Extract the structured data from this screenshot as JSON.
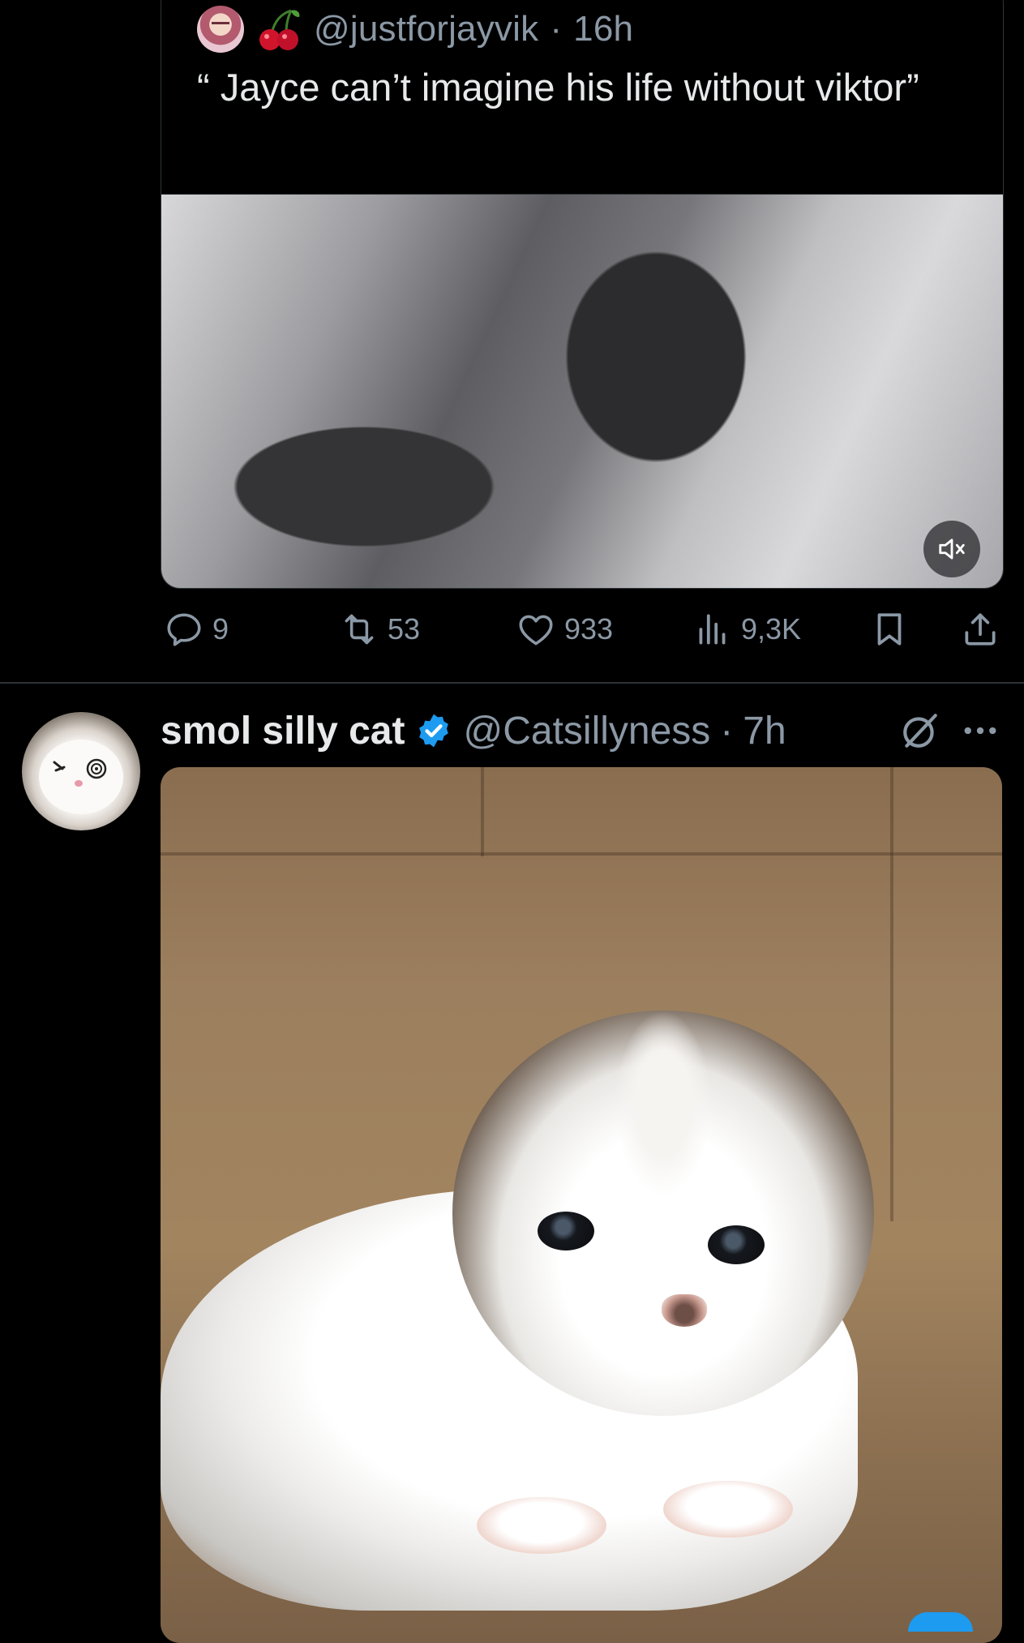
{
  "quoted_tweet": {
    "handle": "@justforjayvik",
    "separator": "·",
    "time": "16h",
    "text": "“ Jayce can’t imagine his life without viktor”",
    "media": {
      "type": "video",
      "muted": true
    }
  },
  "actions": {
    "replies": "9",
    "reposts": "53",
    "likes": "933",
    "views": "9,3K"
  },
  "tweet": {
    "display_name": "smol silly cat",
    "verified": true,
    "handle": "@Catsillyness",
    "separator": "·",
    "time": "7h",
    "media": {
      "type": "image"
    }
  },
  "colors": {
    "background": "#000000",
    "text_primary": "#e7e9ea",
    "text_secondary": "#8b98a5",
    "border": "#2f3336",
    "verified_blue": "#1d9bf0",
    "cherry_red": "#d0142c"
  },
  "icons": [
    "cherry-icon",
    "mute-icon",
    "reply-icon",
    "repost-icon",
    "like-icon",
    "views-icon",
    "bookmark-icon",
    "share-icon",
    "verified-icon",
    "grok-icon",
    "more-icon"
  ]
}
